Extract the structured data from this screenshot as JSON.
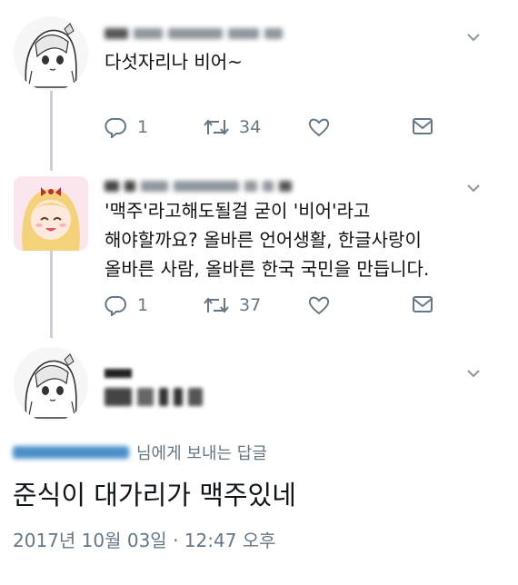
{
  "tweets": [
    {
      "text": "다섯자리나 비어~",
      "reply_count": "1",
      "retweet_count": "34"
    },
    {
      "text_line1": "'맥주'라고해도될걸 굳이 '비어'라고",
      "text_line2": "해야할까요? 올바른 언어생활, 한글사랑이",
      "text_line3": "올바른 사람, 올바른 한국 국민을 만듭니다.",
      "reply_count": "1",
      "retweet_count": "37"
    }
  ],
  "focus_tweet": {
    "reply_to_suffix": "님에게 보내는 답글",
    "text": "준식이 대가리가 맥주있네",
    "timestamp": "2017년 10월 03일 · 12:47 오후"
  },
  "icons": [
    "chevron-down-icon",
    "reply-icon",
    "retweet-icon",
    "like-icon",
    "message-icon"
  ],
  "colors": {
    "icon_gray": "#657786",
    "thread_line": "#c7d0d8",
    "mention_blue": "#4a90c8"
  }
}
